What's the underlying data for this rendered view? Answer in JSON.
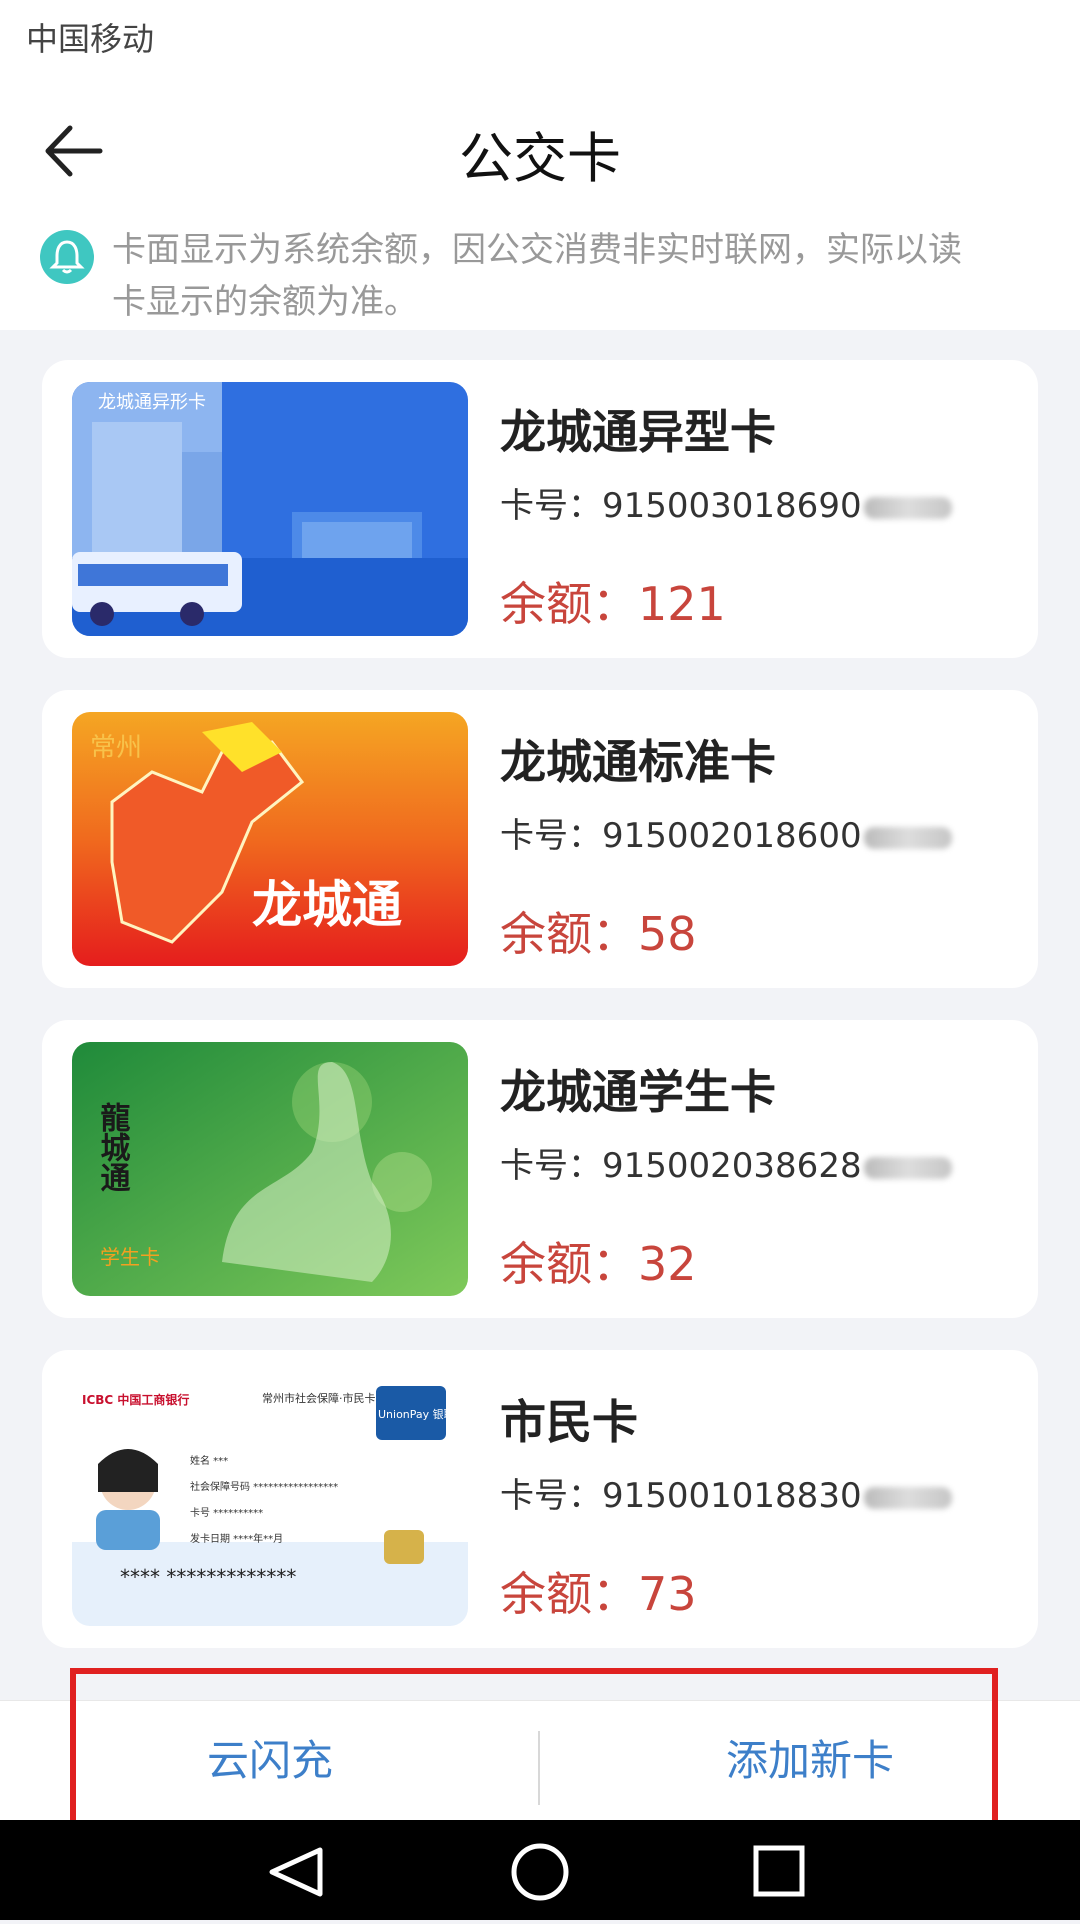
{
  "status_bar": {
    "carrier": "中国移动"
  },
  "header": {
    "title": "公交卡"
  },
  "notice": {
    "text": "卡面显示为系统余额，因公交消费非实时联网，实际以读卡显示的余额为准。",
    "icon": "bell-icon",
    "icon_color": "#3fc7c1"
  },
  "cards": [
    {
      "name": "龙城通异型卡",
      "number": "卡号：915003018690",
      "balance": "余额：121",
      "image_label": "龙城通异形卡"
    },
    {
      "name": "龙城通标准卡",
      "number": "卡号：915002018600",
      "balance": "余额：58",
      "image_label": "龙城通",
      "image_small": "常州"
    },
    {
      "name": "龙城通学生卡",
      "number": "卡号：915002038628",
      "balance": "余额：32",
      "image_label": "龍城通",
      "image_small": "学生卡"
    },
    {
      "name": "市民卡",
      "number": "卡号：915001018830",
      "balance": "余额：73",
      "image_bank": "ICBC 中国工商银行",
      "image_org": "常州市社会保障·市民卡",
      "image_unionpay": "UnionPay 银联",
      "image_fields": [
        "姓名 ***",
        "社会保障号码 *****************",
        "卡号 **********",
        "发卡日期 ****年**月"
      ],
      "image_stars": "****  *************"
    }
  ],
  "bottom_bar": {
    "left": "云闪充",
    "right": "添加新卡"
  },
  "colors": {
    "accent": "#3d7fc9",
    "balance": "#c8453c",
    "highlight_box": "#e02020"
  }
}
